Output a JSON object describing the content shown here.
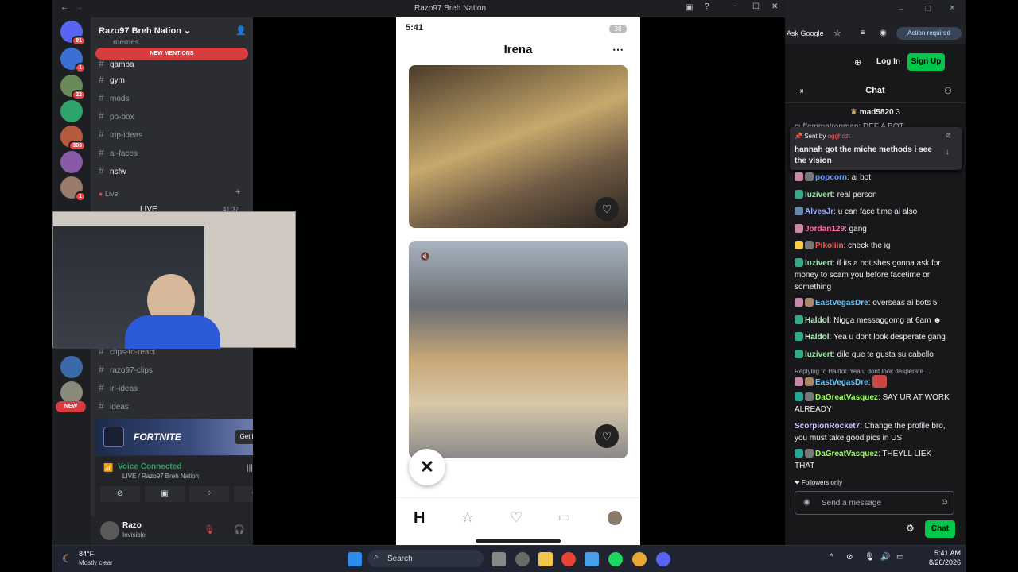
{
  "discord": {
    "window_title": "Razo97 Breh Nation",
    "guild_name": "Razo97 Breh Nation",
    "new_mentions": "NEW MENTIONS",
    "servers": [
      {
        "badge": "81",
        "color": "#5865f2"
      },
      {
        "badge": "1",
        "color": "#3b6fd6"
      },
      {
        "badge": "22",
        "color": "#6a8a5a"
      },
      {
        "badge": "",
        "color": "#2ea36b"
      },
      {
        "badge": "303",
        "color": "#b55a3c"
      },
      {
        "badge": "",
        "color": "#8a5aa8"
      },
      {
        "badge": "1",
        "color": "#9a7a6a"
      }
    ],
    "channels": [
      {
        "name": "memes",
        "bright": false
      },
      {
        "name": "gamba",
        "bright": true
      },
      {
        "name": "gym",
        "bright": true
      },
      {
        "name": "mods",
        "bright": false
      },
      {
        "name": "po-box",
        "bright": false
      },
      {
        "name": "trip-ideas",
        "bright": false
      },
      {
        "name": "ai-faces",
        "bright": false
      },
      {
        "name": "nsfw",
        "bright": true
      }
    ],
    "live_category": "Live",
    "live_channel": "LIVE",
    "live_timer": "41:37",
    "lower_channels": [
      "clips-to-react",
      "razo97-clips",
      "irl-ideas",
      "ideas"
    ],
    "new_badge": "NEW",
    "fortnite": {
      "title": "FORTNITE",
      "button": "Get Reward!"
    },
    "voice": {
      "status": "Voice Connected",
      "location": "LIVE / Razo97 Breh Nation"
    },
    "user": {
      "name": "Razo",
      "status": "Invisible"
    }
  },
  "phone": {
    "time": "5:41",
    "battery": "38",
    "profile_name": "Irena"
  },
  "browser": {
    "ask_google": "Ask Google",
    "action_required": "Action required",
    "login": "Log In",
    "signup": "Sign Up",
    "chat_title": "Chat",
    "top_gifter": "mad5820",
    "top_gifter_count": "3",
    "hidden_line": "cuffemmatronman: DEF A BOT",
    "pinned": {
      "sent_by": "Sent by",
      "sender": "ogghozt",
      "text": "hannah got the miche methods i see the vision"
    },
    "messages": [
      {
        "user": "popcorn",
        "color": "#5c9cff",
        "text": "ai bot"
      },
      {
        "user": "luzivert",
        "color": "#8eeaa0",
        "text": "real person"
      },
      {
        "user": "AlvesJr",
        "color": "#9aa8ff",
        "text": "u can face time ai also"
      },
      {
        "user": "Jordan129",
        "color": "#ff6ea8",
        "text": "gang"
      },
      {
        "user": "Pikoliin",
        "color": "#ff5c5c",
        "text": "check the ig"
      },
      {
        "user": "luzivert",
        "color": "#8eeaa0",
        "text": "if its a bot shes gonna ask for money to scam you before facetime or something"
      },
      {
        "user": "EastVegasDre",
        "color": "#5cc8ff",
        "text": "overseas ai bots 5"
      },
      {
        "user": "Haldol",
        "color": "#bdf5c8",
        "text": "Nigga messaggomg at 6am"
      },
      {
        "user": "Haldol",
        "color": "#bdf5c8",
        "text": "Yea u dont look desperate gang"
      },
      {
        "user": "luzivert",
        "color": "#8eeaa0",
        "text": "dile que te gusta su cabello"
      }
    ],
    "reply_line": "Replying to Haldol: Yea u dont look desperate ...",
    "messages2": [
      {
        "user": "EastVegasDre",
        "color": "#5cc8ff",
        "text": ""
      },
      {
        "user": "DaGreatVasquez",
        "color": "#9cff5c",
        "text": "SAY UR AT WORK ALREADY"
      },
      {
        "user": "ScorpionRocket7",
        "color": "#d0c4ff",
        "text": "Change the profile bro, you must take good pics in US"
      },
      {
        "user": "DaGreatVasquez",
        "color": "#9cff5c",
        "text": "THEYLL LIEK THAT"
      }
    ],
    "followers_only": "Followers only",
    "input_placeholder": "Send a message",
    "chat_button": "Chat"
  },
  "taskbar": {
    "weather_temp": "84°F",
    "weather_desc": "Mostly clear",
    "search": "Search",
    "time": "5:41 AM",
    "date": "8/26/2026"
  }
}
